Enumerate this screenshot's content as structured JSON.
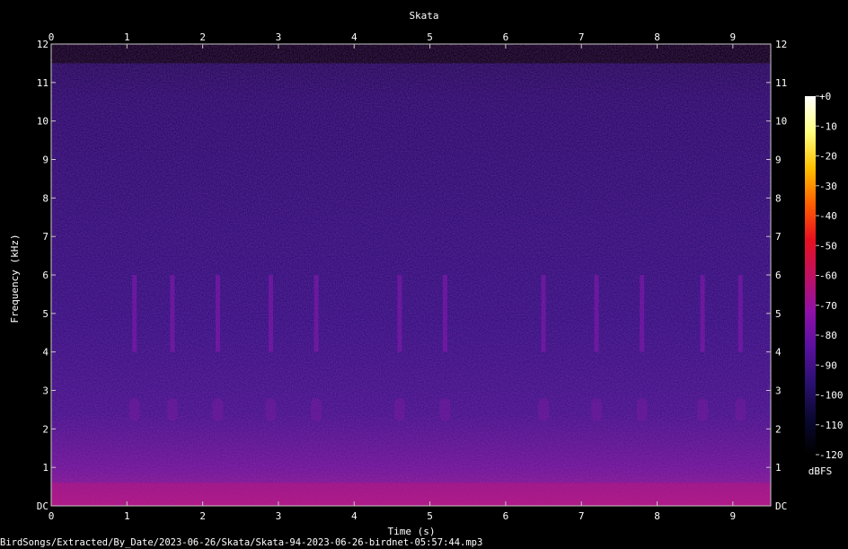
{
  "chart_data": {
    "type": "heatmap",
    "title": "Skata",
    "xlabel": "Time (s)",
    "ylabel": "Frequency (kHz)",
    "xlim": [
      0,
      9.5
    ],
    "ylim": [
      0,
      12
    ],
    "x_ticks": [
      "0",
      "1",
      "2",
      "3",
      "4",
      "5",
      "6",
      "7",
      "8",
      "9"
    ],
    "y_ticks": [
      "DC",
      "1",
      "2",
      "3",
      "4",
      "5",
      "6",
      "7",
      "8",
      "9",
      "10",
      "11",
      "12"
    ],
    "colorbar": {
      "label": "dBFS",
      "range": [
        -120,
        0
      ],
      "ticks": [
        "+0",
        "-10",
        "-20",
        "-30",
        "-40",
        "-50",
        "-60",
        "-70",
        "-80",
        "-90",
        "-100",
        "-110",
        "-120"
      ],
      "colors": [
        "#000000",
        "#0a0830",
        "#2a1070",
        "#5a10a0",
        "#9010a8",
        "#c01060",
        "#e81020",
        "#ff6000",
        "#ffc000",
        "#ffff80",
        "#ffffff"
      ]
    },
    "spectral_content": {
      "background_db": -95,
      "noise_ceiling_khz": 11.5,
      "low_freq_energy_db": -75,
      "call_onsets_s": [
        1.1,
        1.6,
        2.2,
        2.9,
        3.5,
        4.6,
        5.2,
        6.5,
        7.2,
        7.8,
        8.6,
        9.1
      ],
      "call_band_khz": [
        4.0,
        6.0
      ],
      "harmonic_band_khz": [
        2.2,
        2.8
      ]
    },
    "caption": "BirdSongs/Extracted/By_Date/2023-06-26/Skata/Skata-94-2023-06-26-birdnet-05:57:44.mp3"
  }
}
